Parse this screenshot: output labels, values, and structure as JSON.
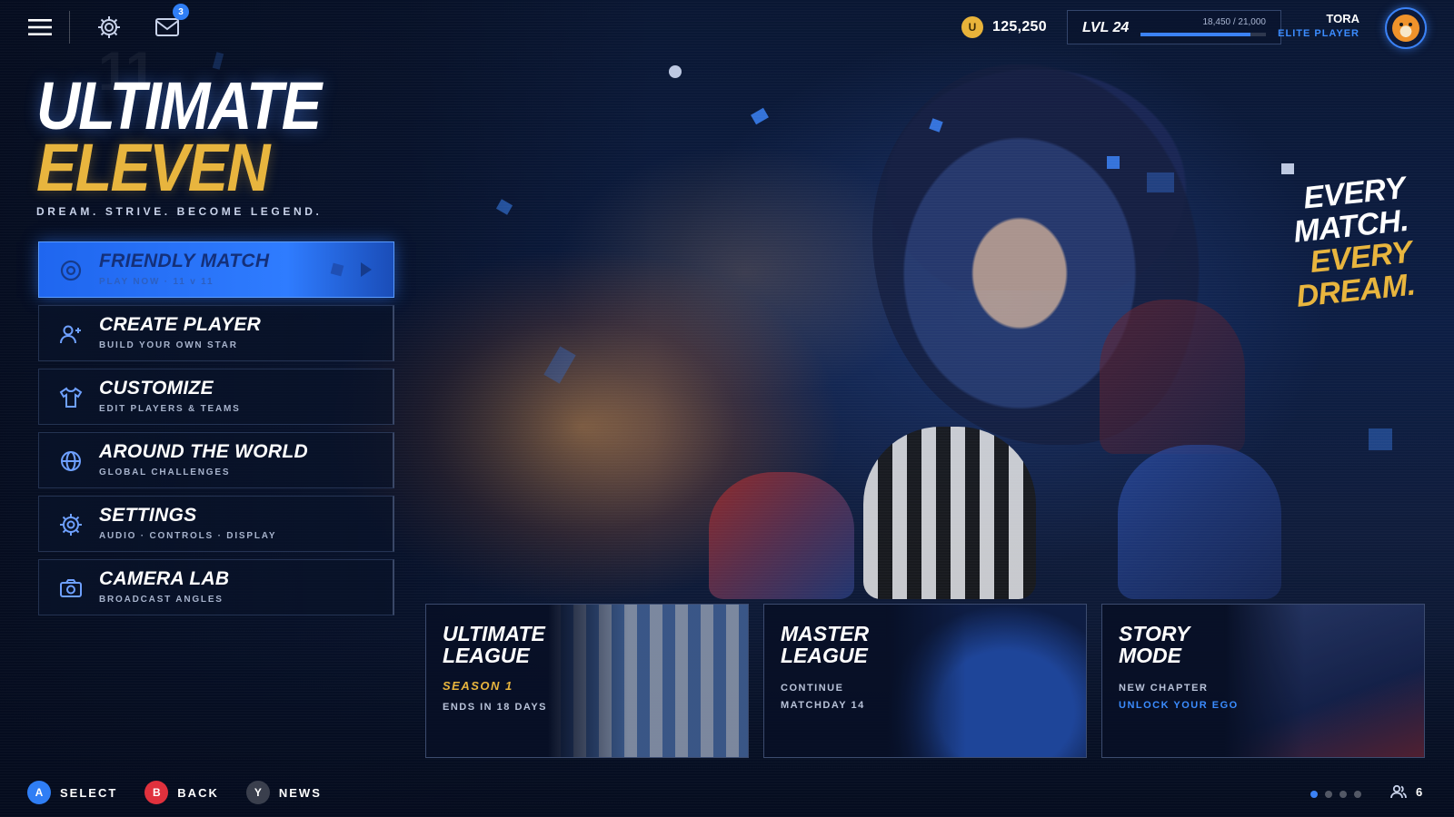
{
  "header": {
    "menu_icon": "hamburger-menu-icon",
    "settings_icon": "gear-icon",
    "mail_icon": "mail-icon",
    "mail_badge": "3",
    "coins": {
      "icon_letter": "U",
      "value": "125,250"
    },
    "level": {
      "label": "LVL 24",
      "xp_text": "18,450 / 21,000",
      "xp_fraction": 0.8786
    },
    "profile": {
      "name": "TORA",
      "rank": "ELITE PLAYER",
      "avatar": "tiger-avatar"
    }
  },
  "logo": {
    "watermark": "11",
    "line1": "ULTIMATE",
    "line2": "ELEVEN",
    "tagline": "DREAM. STRIVE. BECOME LEGEND."
  },
  "menu": {
    "items": [
      {
        "title": "FRIENDLY MATCH",
        "subtitle": "PLAY NOW · 11 v 11",
        "icon": "target-icon",
        "active": true
      },
      {
        "title": "CREATE PLAYER",
        "subtitle": "BUILD YOUR OWN STAR",
        "icon": "add-user-icon",
        "active": false
      },
      {
        "title": "CUSTOMIZE",
        "subtitle": "EDIT PLAYERS & TEAMS",
        "icon": "shirt-icon",
        "active": false
      },
      {
        "title": "AROUND THE WORLD",
        "subtitle": "GLOBAL CHALLENGES",
        "icon": "globe-icon",
        "active": false
      },
      {
        "title": "SETTINGS",
        "subtitle": "AUDIO · CONTROLS · DISPLAY",
        "icon": "gear-icon",
        "active": false
      },
      {
        "title": "CAMERA LAB",
        "subtitle": "BROADCAST ANGLES",
        "icon": "camera-icon",
        "active": false
      }
    ]
  },
  "slogan": {
    "line1": "EVERY",
    "line2": "MATCH.",
    "line3": "EVERY",
    "line4": "DREAM."
  },
  "cards": [
    {
      "title": "ULTIMATE LEAGUE",
      "tag": "SEASON 1",
      "line1": "ENDS IN 18 DAYS",
      "line2": ""
    },
    {
      "title": "MASTER LEAGUE",
      "tag": "",
      "line1": "CONTINUE",
      "line2": "MATCHDAY 14"
    },
    {
      "title": "STORY MODE",
      "tag": "",
      "line1": "NEW CHAPTER",
      "line2": "UNLOCK YOUR EGO"
    }
  ],
  "footer": {
    "buttons": [
      {
        "key": "A",
        "label": "SELECT",
        "color": "#2f7ef5"
      },
      {
        "key": "B",
        "label": "BACK",
        "color": "#e0313d"
      },
      {
        "key": "Y",
        "label": "NEWS",
        "color": "#3a3f4d"
      }
    ],
    "page_dots": 4,
    "active_dot": 0,
    "online_count": "6",
    "online_icon": "users-icon"
  },
  "colors": {
    "accent": "#2f7cff",
    "gold": "#e8b53e",
    "bg": "#071126"
  }
}
